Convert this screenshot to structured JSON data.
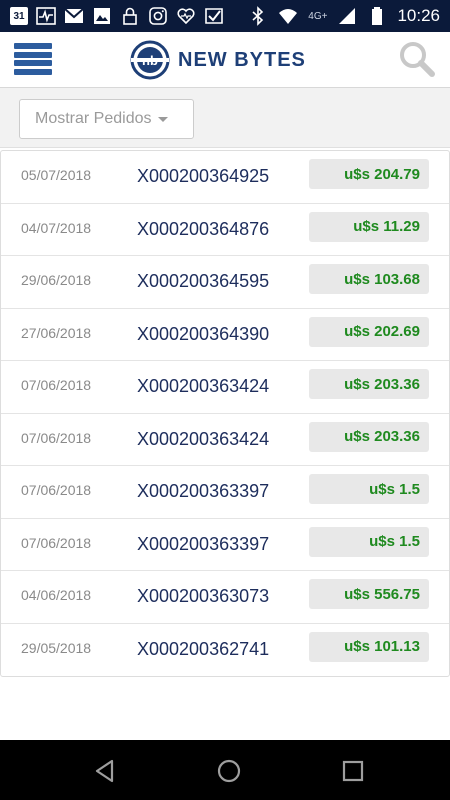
{
  "status_bar": {
    "calendar_day": "31",
    "network": "4G+",
    "time": "10:26",
    "icons": [
      "calendar-icon",
      "pulse-icon",
      "gmail-icon",
      "image-icon",
      "lock-icon",
      "instagram-icon",
      "heart-icon",
      "check-app-icon",
      "bluetooth-icon",
      "wifi-icon",
      "signal-icon",
      "battery-icon"
    ]
  },
  "header": {
    "logo_mark": "nb",
    "logo_text": "NEW BYTES"
  },
  "filter": {
    "label": "Mostrar Pedidos"
  },
  "orders": [
    {
      "date": "05/07/2018",
      "id": "X000200364925",
      "amount": "u$s 204.79"
    },
    {
      "date": "04/07/2018",
      "id": "X000200364876",
      "amount": "u$s 11.29"
    },
    {
      "date": "29/06/2018",
      "id": "X000200364595",
      "amount": "u$s 103.68"
    },
    {
      "date": "27/06/2018",
      "id": "X000200364390",
      "amount": "u$s 202.69"
    },
    {
      "date": "07/06/2018",
      "id": "X000200363424",
      "amount": "u$s 203.36"
    },
    {
      "date": "07/06/2018",
      "id": "X000200363424",
      "amount": "u$s 203.36"
    },
    {
      "date": "07/06/2018",
      "id": "X000200363397",
      "amount": "u$s 1.5"
    },
    {
      "date": "07/06/2018",
      "id": "X000200363397",
      "amount": "u$s 1.5"
    },
    {
      "date": "04/06/2018",
      "id": "X000200363073",
      "amount": "u$s 556.75"
    },
    {
      "date": "29/05/2018",
      "id": "X000200362741",
      "amount": "u$s 101.13"
    }
  ],
  "colors": {
    "status_bar": "#0b1a3a",
    "brand": "#1e3f77",
    "menu": "#2c5c9e",
    "amount": "#1f8a1f",
    "order_id": "#1d2d5c"
  },
  "nav": {
    "icons": [
      "back-icon",
      "home-icon",
      "recents-icon"
    ]
  }
}
